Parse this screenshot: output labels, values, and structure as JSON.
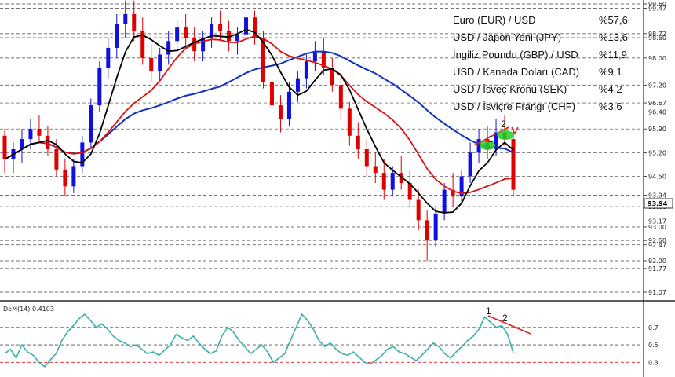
{
  "chart_data": {
    "type": "candlestick",
    "price_axis": {
      "ticks": [
        "99.60",
        "99.47",
        "98.72",
        "98.60",
        "98.00",
        "97.20",
        "96.67",
        "96.40",
        "95.90",
        "95.20",
        "94.50",
        "93.94",
        "93.60",
        "93.17",
        "93.00",
        "92.60",
        "92.47",
        "92.00",
        "91.77",
        "91.07"
      ],
      "current_price": "93.94",
      "ylim": [
        91.07,
        99.6
      ]
    },
    "legend": [
      {
        "label": "Euro (EUR) / USD",
        "value": "%57,6"
      },
      {
        "label": "USD / Japon Yeni (JPY)",
        "value": "%13,6"
      },
      {
        "label": "İngiliz Poundu (GBP) / USD",
        "value": "%11,9"
      },
      {
        "label": "USD / Kanada Doları (CAD)",
        "value": "%9,1"
      },
      {
        "label": "USD / İsveç Kronu (SEK)",
        "value": "%4,2"
      },
      {
        "label": "USD / İsviçre Frangı (CHF)",
        "value": "%3,6"
      }
    ],
    "annotations": {
      "price_top_1": "1",
      "price_top_2": "2",
      "ind_top_1": "1",
      "ind_top_2": "2"
    },
    "series_colors": {
      "bull": "#1010e0",
      "bear": "#e00000",
      "ma_fast": "#000000",
      "ma_mid": "#e01010",
      "ma_slow": "#1030c0",
      "dem": "#3bb0a8",
      "trend": "#e02020",
      "highlight": "#22cc22"
    },
    "indicator": {
      "name": "DeM(14) 0.4103",
      "ticks": [
        "0.7",
        "0.5",
        "0.3"
      ],
      "levels": [
        0.7,
        0.5,
        0.3
      ],
      "ylim": [
        0.15,
        0.95
      ],
      "values": [
        0.4,
        0.45,
        0.35,
        0.5,
        0.42,
        0.38,
        0.3,
        0.25,
        0.33,
        0.4,
        0.55,
        0.65,
        0.72,
        0.8,
        0.85,
        0.78,
        0.7,
        0.74,
        0.68,
        0.6,
        0.55,
        0.52,
        0.48,
        0.5,
        0.45,
        0.4,
        0.42,
        0.38,
        0.44,
        0.5,
        0.62,
        0.58,
        0.55,
        0.6,
        0.52,
        0.45,
        0.4,
        0.43,
        0.6,
        0.7,
        0.65,
        0.55,
        0.48,
        0.4,
        0.45,
        0.5,
        0.42,
        0.3,
        0.35,
        0.4,
        0.55,
        0.7,
        0.85,
        0.78,
        0.68,
        0.55,
        0.48,
        0.52,
        0.45,
        0.4,
        0.38,
        0.42,
        0.36,
        0.3,
        0.28,
        0.33,
        0.38,
        0.45,
        0.48,
        0.42,
        0.4,
        0.36,
        0.32,
        0.38,
        0.45,
        0.52,
        0.48,
        0.4,
        0.35,
        0.42,
        0.48,
        0.55,
        0.6,
        0.68,
        0.82,
        0.76,
        0.7,
        0.72,
        0.62,
        0.41
      ]
    },
    "candles": [
      [
        95.7,
        95.9,
        94.6,
        95.0
      ],
      [
        95.0,
        95.5,
        94.6,
        95.3
      ],
      [
        95.3,
        95.9,
        94.9,
        95.6
      ],
      [
        95.6,
        96.2,
        95.3,
        95.9
      ],
      [
        95.9,
        96.3,
        95.5,
        95.7
      ],
      [
        95.7,
        96.0,
        95.1,
        95.3
      ],
      [
        95.3,
        95.6,
        94.5,
        94.7
      ],
      [
        94.7,
        95.0,
        93.9,
        94.2
      ],
      [
        94.2,
        95.0,
        94.0,
        94.8
      ],
      [
        94.8,
        95.7,
        94.6,
        95.5
      ],
      [
        95.5,
        96.8,
        95.3,
        96.6
      ],
      [
        96.6,
        97.9,
        96.4,
        97.7
      ],
      [
        97.7,
        98.6,
        97.4,
        98.3
      ],
      [
        98.3,
        99.3,
        98.0,
        99.0
      ],
      [
        99.0,
        99.7,
        98.6,
        99.3
      ],
      [
        99.3,
        99.7,
        98.5,
        98.8
      ],
      [
        98.8,
        99.2,
        97.8,
        98.0
      ],
      [
        98.0,
        98.4,
        97.3,
        97.6
      ],
      [
        97.6,
        98.3,
        97.3,
        98.1
      ],
      [
        98.1,
        98.8,
        97.8,
        98.5
      ],
      [
        98.5,
        99.1,
        98.2,
        98.9
      ],
      [
        98.9,
        99.3,
        98.3,
        98.6
      ],
      [
        98.6,
        98.9,
        97.9,
        98.2
      ],
      [
        98.2,
        98.8,
        97.9,
        98.6
      ],
      [
        98.6,
        99.2,
        98.3,
        99.0
      ],
      [
        99.0,
        99.4,
        98.5,
        98.8
      ],
      [
        98.8,
        99.1,
        98.2,
        98.5
      ],
      [
        98.5,
        98.9,
        98.1,
        98.7
      ],
      [
        98.7,
        99.5,
        98.5,
        99.2
      ],
      [
        99.2,
        99.4,
        98.4,
        98.6
      ],
      [
        98.6,
        98.8,
        97.1,
        97.3
      ],
      [
        97.3,
        97.6,
        96.3,
        96.6
      ],
      [
        96.6,
        96.9,
        95.8,
        96.2
      ],
      [
        96.2,
        97.3,
        96.0,
        97.0
      ],
      [
        97.0,
        97.6,
        96.7,
        97.4
      ],
      [
        97.4,
        98.1,
        97.1,
        97.9
      ],
      [
        97.9,
        98.5,
        97.6,
        98.2
      ],
      [
        98.2,
        98.6,
        97.5,
        97.7
      ],
      [
        97.7,
        98.0,
        97.0,
        97.2
      ],
      [
        97.2,
        97.4,
        96.2,
        96.5
      ],
      [
        96.5,
        96.7,
        95.4,
        95.7
      ],
      [
        95.7,
        96.1,
        95.0,
        95.3
      ],
      [
        95.3,
        95.6,
        94.5,
        94.8
      ],
      [
        94.8,
        95.2,
        94.3,
        94.6
      ],
      [
        94.6,
        95.0,
        93.8,
        94.1
      ],
      [
        94.1,
        94.8,
        93.9,
        94.6
      ],
      [
        94.6,
        95.1,
        94.1,
        94.3
      ],
      [
        94.3,
        94.7,
        93.6,
        93.8
      ],
      [
        93.8,
        94.1,
        92.9,
        93.2
      ],
      [
        93.2,
        93.5,
        92.0,
        92.6
      ],
      [
        92.6,
        93.6,
        92.4,
        93.4
      ],
      [
        93.4,
        94.3,
        93.2,
        94.1
      ],
      [
        94.1,
        94.6,
        93.6,
        93.9
      ],
      [
        93.9,
        94.7,
        93.7,
        94.5
      ],
      [
        94.5,
        95.5,
        94.3,
        95.2
      ],
      [
        95.2,
        95.9,
        94.9,
        95.6
      ],
      [
        95.6,
        96.0,
        95.0,
        95.3
      ],
      [
        95.3,
        96.2,
        95.1,
        95.8
      ],
      [
        95.8,
        96.3,
        95.4,
        95.6
      ],
      [
        95.6,
        95.9,
        93.9,
        94.1
      ]
    ]
  }
}
